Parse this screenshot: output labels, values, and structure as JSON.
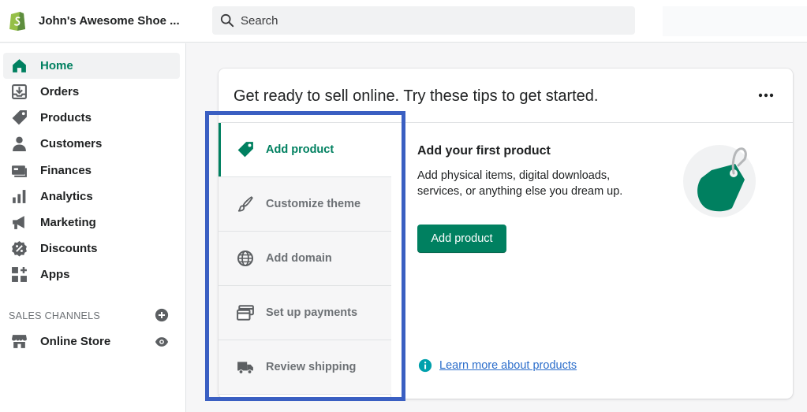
{
  "topbar": {
    "store_name": "John's Awesome Shoe ...",
    "search_placeholder": "Search"
  },
  "sidebar": {
    "items": [
      {
        "label": "Home",
        "icon": "home-icon",
        "active": true
      },
      {
        "label": "Orders",
        "icon": "orders-icon"
      },
      {
        "label": "Products",
        "icon": "tag-icon"
      },
      {
        "label": "Customers",
        "icon": "person-icon"
      },
      {
        "label": "Finances",
        "icon": "finances-icon"
      },
      {
        "label": "Analytics",
        "icon": "bar-chart-icon"
      },
      {
        "label": "Marketing",
        "icon": "megaphone-icon"
      },
      {
        "label": "Discounts",
        "icon": "discount-icon"
      },
      {
        "label": "Apps",
        "icon": "apps-icon"
      }
    ],
    "section_title": "SALES CHANNELS",
    "channel": {
      "label": "Online Store",
      "icon": "store-icon"
    }
  },
  "card": {
    "title": "Get ready to sell online. Try these tips to get started.",
    "tips": [
      {
        "label": "Add product",
        "icon": "tag-icon",
        "active": true
      },
      {
        "label": "Customize theme",
        "icon": "brush-icon"
      },
      {
        "label": "Add domain",
        "icon": "globe-icon"
      },
      {
        "label": "Set up payments",
        "icon": "card-icon"
      },
      {
        "label": "Review shipping",
        "icon": "truck-icon"
      }
    ],
    "detail": {
      "title": "Add your first product",
      "description": "Add physical items, digital downloads, services, or anything else you dream up.",
      "button": "Add product",
      "link": "Learn more about products"
    }
  },
  "colors": {
    "accent": "#008060",
    "link": "#2c6ecb",
    "highlight_outline": "#3a5fc2"
  }
}
